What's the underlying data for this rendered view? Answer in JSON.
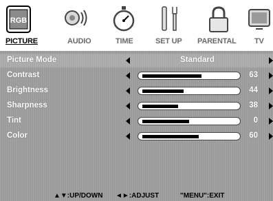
{
  "tabs": [
    {
      "label": "PICTURE",
      "icon": "picture-icon",
      "active": true
    },
    {
      "label": "AUDIO",
      "icon": "audio-icon",
      "active": false
    },
    {
      "label": "TIME",
      "icon": "timer-icon",
      "active": false
    },
    {
      "label": "SET UP",
      "icon": "setup-tools-icon",
      "active": false
    },
    {
      "label": "PARENTAL",
      "icon": "lock-icon",
      "active": false
    },
    {
      "label": "TV",
      "icon": "tv-icon",
      "active": false
    }
  ],
  "picture_icon_text": "RGB",
  "menu": {
    "picture_mode": {
      "label": "Picture Mode",
      "value": "Standard"
    },
    "settings": [
      {
        "label": "Contrast",
        "value": "63",
        "level": 63
      },
      {
        "label": "Brightness",
        "value": "44",
        "level": 44
      },
      {
        "label": "Sharpness",
        "value": "38",
        "level": 38
      },
      {
        "label": "Tint",
        "value": "0",
        "level": 50
      },
      {
        "label": "Color",
        "value": "60",
        "level": 60
      }
    ]
  },
  "help": {
    "updown": "▲▼:UP/DOWN",
    "adjust": "◄►:ADJUST",
    "exit": "\"MENU\":EXIT"
  }
}
